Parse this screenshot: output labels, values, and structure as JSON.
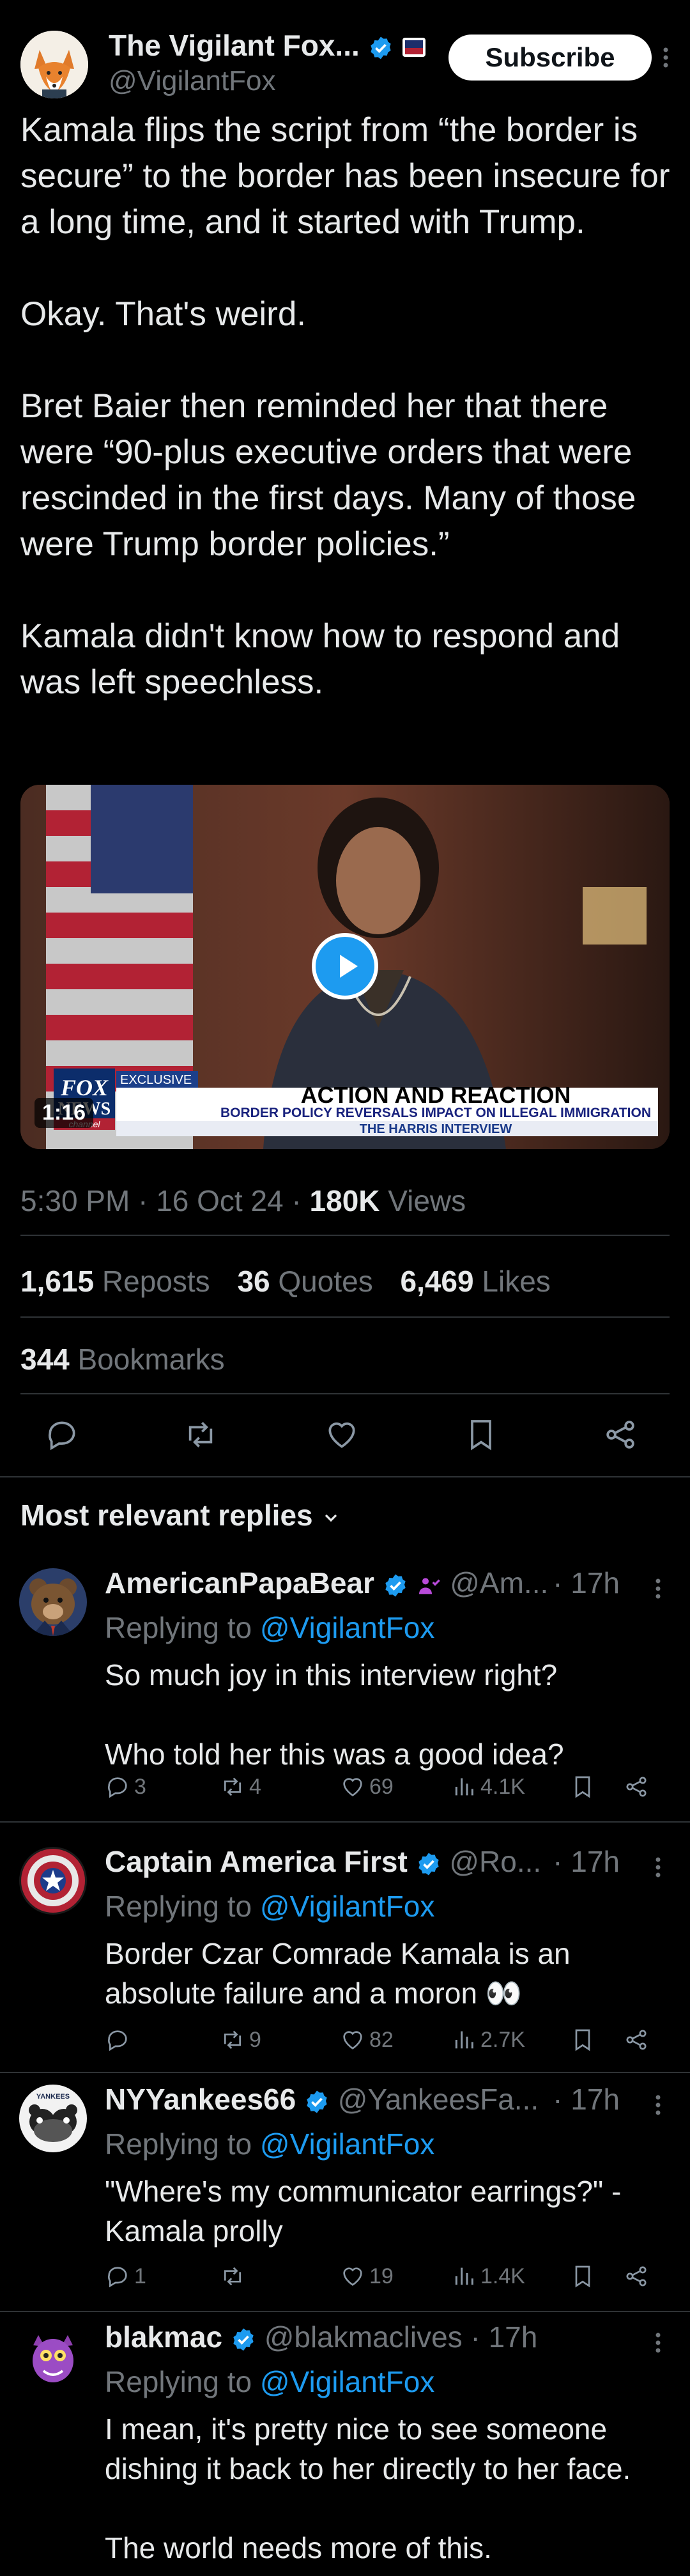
{
  "author": {
    "name": "The Vigilant Fox...",
    "handle": "@VigilantFox",
    "subscribe_label": "Subscribe"
  },
  "post": {
    "text": "Kamala flips the script from “the border is secure” to the border has been insecure for a long time, and it started with Trump.\n\nOkay. That's weird.\n\nBret Baier then reminded her that there were “90-plus executive orders that were rescinded in the first days. Many of those were Trump border policies.”\n\nKamala didn't know how to respond and was left speechless.",
    "video": {
      "duration": "1:16",
      "chyron_tag": "EXCLUSIVE",
      "chyron_title": "ACTION AND REACTION",
      "chyron_sub": "BORDER POLICY REVERSALS IMPACT ON ILLEGAL IMMIGRATION",
      "chyron_show": "THE HARRIS INTERVIEW",
      "logo_top": "FOX",
      "logo_bottom": "NEWS",
      "logo_tag": "channel"
    },
    "time": "5:30 PM · 16 Oct 24 · ",
    "views_count": "180K",
    "views_label": " Views",
    "reposts_count": "1,615",
    "reposts_label": " Reposts",
    "quotes_count": "36",
    "quotes_label": " Quotes",
    "likes_count": "6,469",
    "likes_label": " Likes",
    "bookmarks_count": "344",
    "bookmarks_label": " Bookmarks"
  },
  "replies_header": "Most relevant replies",
  "replies": [
    {
      "name": "AmericanPapaBear",
      "handle": "@Am...",
      "time": "· 17h",
      "replying_prefix": "Replying to ",
      "replying_to": "@VigilantFox",
      "text": "So much joy in this interview right?\n\nWho told her this was a good idea?",
      "replies": "3",
      "reposts": "4",
      "likes": "69",
      "views": "4.1K"
    },
    {
      "name": "Captain America First",
      "handle": "@Ro...",
      "time": "· 17h",
      "replying_prefix": "Replying to ",
      "replying_to": "@VigilantFox",
      "text": "Border Czar Comrade Kamala is an absolute failure and a moron 👀",
      "replies": "",
      "reposts": "9",
      "likes": "82",
      "views": "2.7K"
    },
    {
      "name": "NYYankees66",
      "handle": "@YankeesFa...",
      "time": "· 17h",
      "replying_prefix": "Replying to ",
      "replying_to": "@VigilantFox",
      "text": "\"Where's my communicator earrings?\" -Kamala prolly",
      "replies": "1",
      "reposts": "",
      "likes": "19",
      "views": "1.4K"
    },
    {
      "name": "blakmac",
      "handle": "@blakmaclives",
      "time": "· 17h",
      "replying_prefix": "Replying to ",
      "replying_to": "@VigilantFox",
      "text": "I mean, it's pretty nice to see someone dishing it back to her directly to her face.\n\nThe world needs more of this."
    }
  ],
  "colors": {
    "background": "#000000",
    "text": "#e7e9ea",
    "muted": "#71767b",
    "accent": "#1d9bf0",
    "divider": "#2f3336"
  },
  "icons": [
    "fox-avatar",
    "verified-badge-icon",
    "affiliate-badge-icon",
    "play-icon",
    "reply-icon",
    "repost-icon",
    "like-icon",
    "views-icon",
    "bookmark-icon",
    "share-icon",
    "more-icon",
    "chevron-down-icon"
  ]
}
